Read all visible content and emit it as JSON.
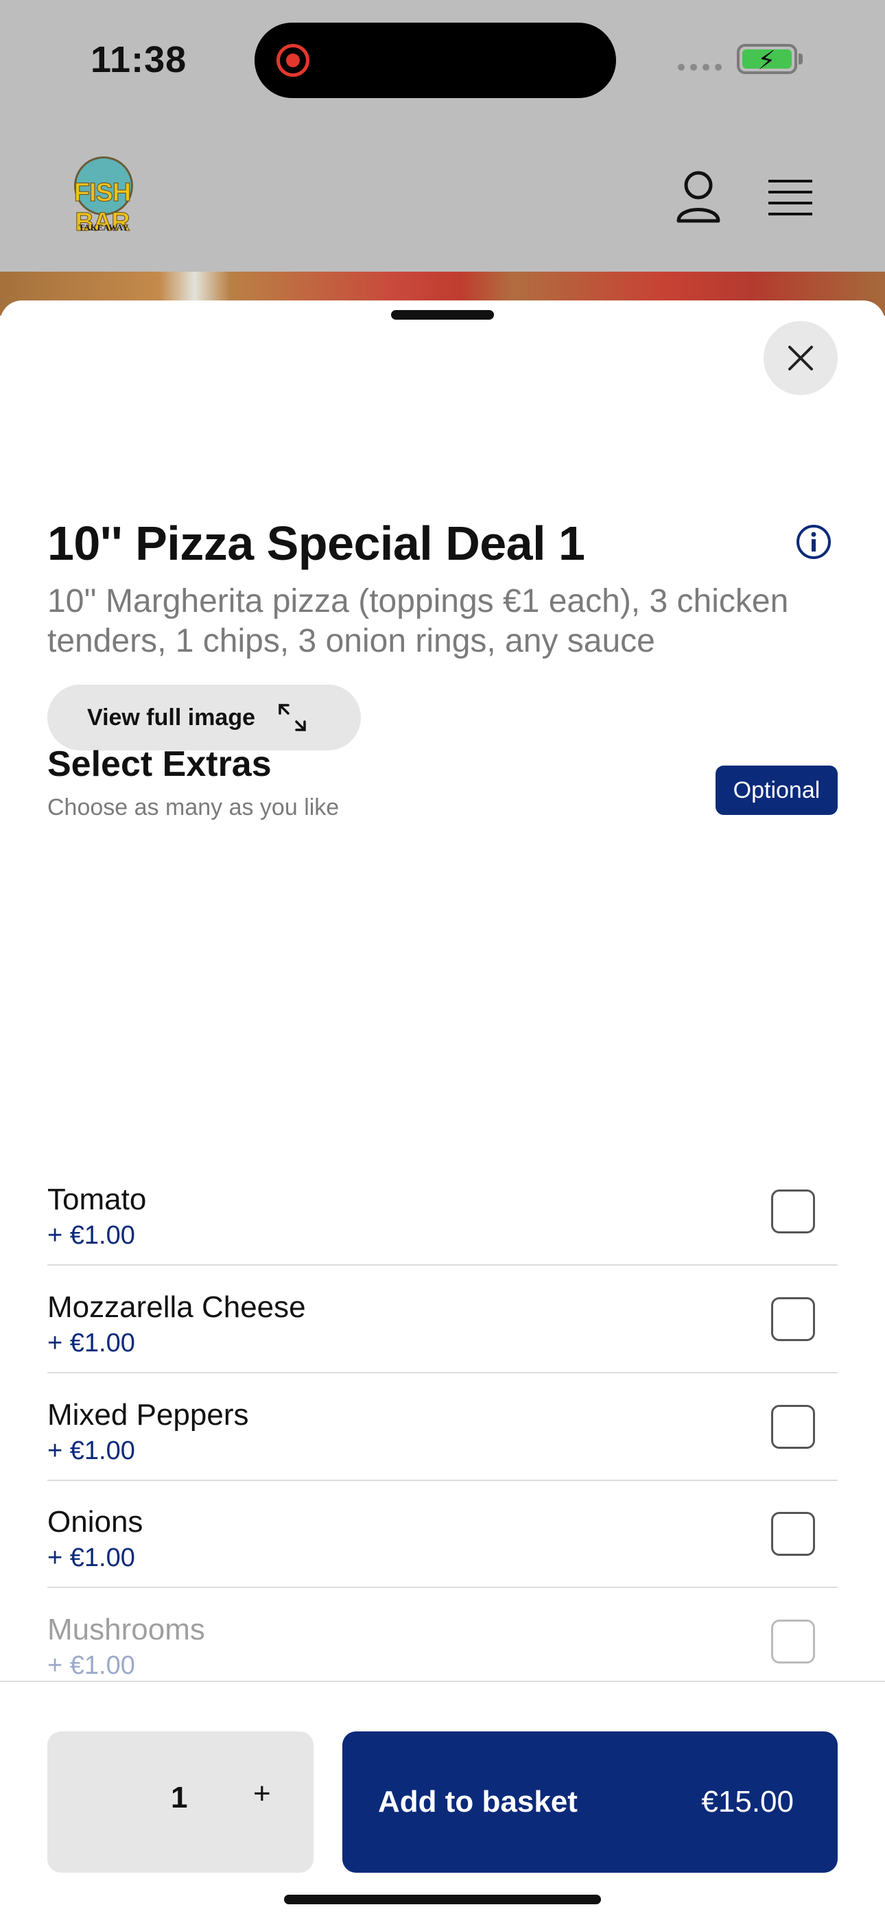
{
  "status_bar": {
    "time": "11:38"
  },
  "brand": {
    "logo_text": "FISH BAR",
    "logo_sub": "TAKEAWAY"
  },
  "product": {
    "view_image_label": "View full image",
    "title": "10'' Pizza Special Deal 1",
    "description": "10'' Margherita pizza (toppings €1 each), 3 chicken tenders, 1 chips, 3 onion rings, any sauce"
  },
  "extras": {
    "title": "Select Extras",
    "subtitle": "Choose as many as you like",
    "badge": "Optional",
    "options": [
      {
        "name": "Tomato",
        "price": "+ €1.00",
        "checked": false
      },
      {
        "name": "Mozzarella Cheese",
        "price": "+ €1.00",
        "checked": false
      },
      {
        "name": "Mixed Peppers",
        "price": "+ €1.00",
        "checked": false
      },
      {
        "name": "Onions",
        "price": "+ €1.00",
        "checked": false
      },
      {
        "name": "Mushrooms",
        "price": "+ €1.00",
        "checked": false
      }
    ]
  },
  "footer": {
    "quantity": "1",
    "plus": "+",
    "add_label": "Add to basket",
    "total": "€15.00"
  },
  "colors": {
    "primary": "#0b2a7a",
    "overlay": "#bdbdbd"
  }
}
